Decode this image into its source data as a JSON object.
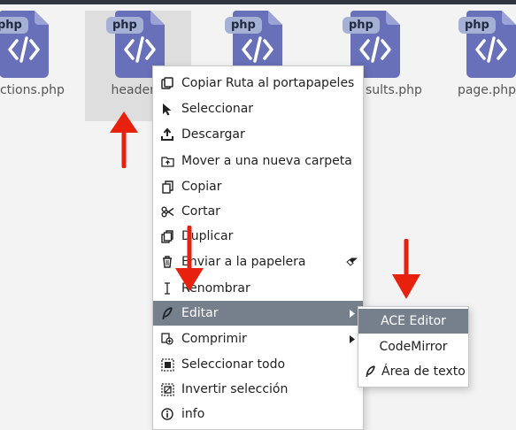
{
  "files": [
    {
      "name": "nctions.php",
      "badge": "php",
      "selected": false
    },
    {
      "name": "header.",
      "badge": "php",
      "selected": true
    },
    {
      "name": "",
      "badge": "php",
      "selected": false
    },
    {
      "name": "sults.php",
      "badge": "php",
      "selected": false
    },
    {
      "name": "page.php",
      "badge": "php",
      "selected": false
    }
  ],
  "context_menu": {
    "items": [
      {
        "label": "Copiar Ruta al portapapeles",
        "icon": "link-icon"
      },
      {
        "label": "Seleccionar",
        "icon": "cursor-icon"
      },
      {
        "label": "Descargar",
        "icon": "download-icon"
      },
      {
        "label": "Mover a una nueva carpeta",
        "icon": "folder-move-icon"
      },
      {
        "label": "Copiar",
        "icon": "copy-icon"
      },
      {
        "label": "Cortar",
        "icon": "scissors-icon"
      },
      {
        "label": "Duplicar",
        "icon": "duplicate-icon"
      },
      {
        "label": "Enviar a la papelera",
        "icon": "trash-icon",
        "tail_icon": "eraser-icon"
      },
      {
        "label": "Renombrar",
        "icon": "text-cursor-icon"
      },
      {
        "label": "Editar",
        "icon": "feather-icon",
        "submenu": true,
        "active": true
      },
      {
        "label": "Comprimir",
        "icon": "compress-icon",
        "submenu": true
      },
      {
        "label": "Seleccionar todo",
        "icon": "select-all-icon"
      },
      {
        "label": "Invertir selección",
        "icon": "invert-selection-icon"
      },
      {
        "label": "info",
        "icon": "info-icon"
      }
    ]
  },
  "edit_submenu": {
    "items": [
      {
        "label": "ACE Editor",
        "highlighted": true
      },
      {
        "label": "CodeMirror"
      },
      {
        "label": "Área de texto",
        "icon": "feather-icon"
      }
    ]
  },
  "colors": {
    "doc_icon": "#6770b8",
    "badge_bg": "#a4b0d4",
    "menu_active_bg": "#76808d",
    "annotation_arrow": "#e8210f"
  }
}
